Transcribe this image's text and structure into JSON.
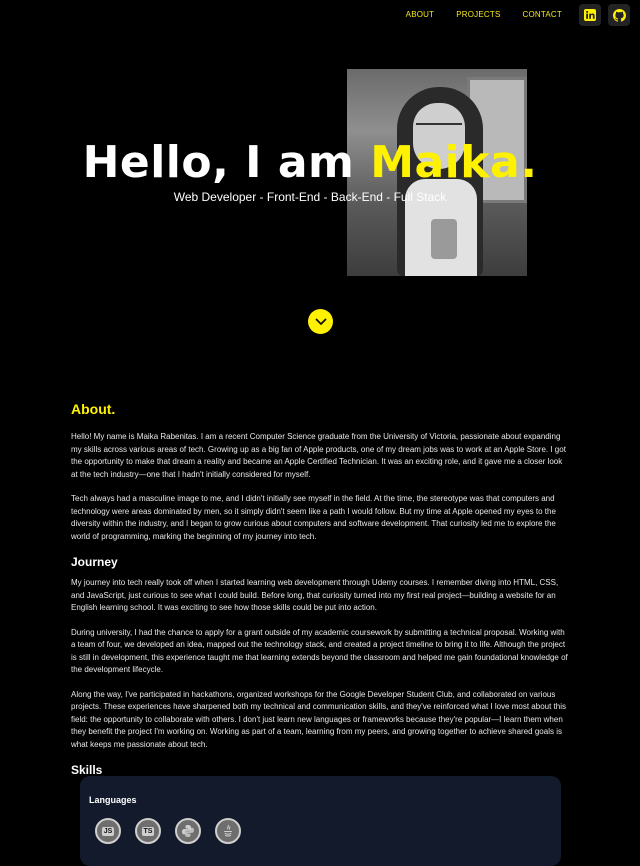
{
  "nav": {
    "about": "ABOUT",
    "projects": "PROJECTS",
    "contact": "CONTACT",
    "icons": [
      "linkedin-icon",
      "github-icon"
    ]
  },
  "hero": {
    "greeting": "Hello, I am ",
    "name": "Maika.",
    "subtitle": "Web Developer - Front-End - Back-End - Full Stack"
  },
  "about": {
    "heading": "About.",
    "p1": "Hello! My name is Maika Rabenitas. I am a recent Computer Science graduate from the University of Victoria, passionate about expanding my skills across various areas of tech. Growing up as a big fan of Apple products, one of my dream jobs was to work at an Apple Store. I got the opportunity to make that dream a reality and became an Apple Certified Technician. It was an exciting role, and it gave me a closer look at the tech industry—one that I hadn't initially considered for myself.",
    "p2": "Tech always had a masculine image to me, and I didn't initially see myself in the field. At the time, the stereotype was that computers and technology were areas dominated by men, so it simply didn't seem like a path I would follow. But my time at Apple opened my eyes to the diversity within the industry, and I began to grow curious about computers and software development. That curiosity led me to explore the world of programming, marking the beginning of my journey into tech."
  },
  "journey": {
    "heading": "Journey",
    "p1": "My journey into tech really took off when I started learning web development through Udemy courses. I remember diving into HTML, CSS, and JavaScript, just curious to see what I could build. Before long, that curiosity turned into my first real project—building a website for an English learning school. It was exciting to see how those skills could be put into action.",
    "p2": "During university, I had the chance to apply for a grant outside of my academic coursework by submitting a technical proposal. Working with a team of four, we developed an idea, mapped out the technology stack, and created a project timeline to bring it to life. Although the project is still in development, this experience taught me that learning extends beyond the classroom and helped me gain foundational knowledge of the development lifecycle.",
    "p3": "Along the way, I've participated in hackathons, organized workshops for the Google Developer Student Club, and collaborated on various projects. These experiences have sharpened both my technical and communication skills, and they've reinforced what I love most about this field: the opportunity to collaborate with others. I don't just learn new languages or frameworks because they're popular—I learn them when they benefit the project I'm working on. Working as part of a team, learning from my peers, and growing together to achieve shared goals is what keeps me passionate about tech."
  },
  "skills": {
    "heading": "Skills",
    "languages_label": "Languages",
    "items": [
      {
        "icon": "javascript-icon",
        "tag": "JS"
      },
      {
        "icon": "typescript-icon",
        "tag": "TS"
      },
      {
        "icon": "python-icon",
        "tag": ""
      },
      {
        "icon": "java-icon",
        "tag": ""
      }
    ]
  },
  "colors": {
    "accent": "#fff200",
    "background": "#000000",
    "card": "#121a2b"
  }
}
